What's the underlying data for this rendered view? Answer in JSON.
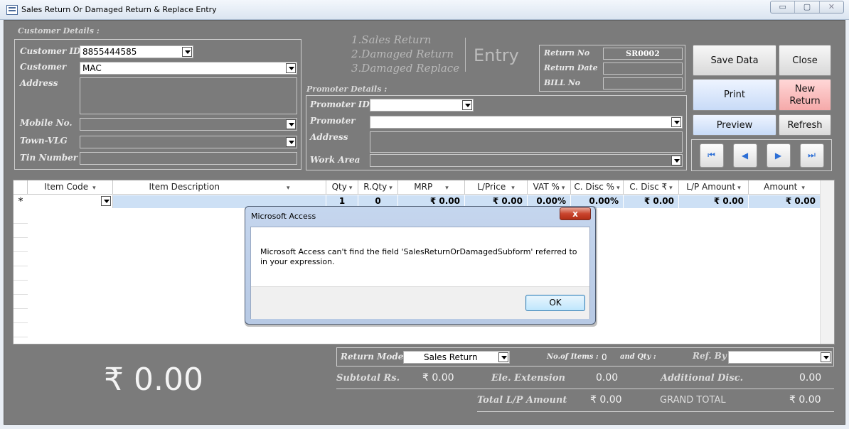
{
  "window": {
    "title": "Sales Return Or Damaged Return & Replace Entry",
    "minimize": "▭",
    "maximize": "▢",
    "close": "✕"
  },
  "customer": {
    "section_label": "Customer Details :",
    "id_label": "Customer ID",
    "id_value": "8855444585",
    "name_label": "Customer",
    "name_value": "MAC",
    "address_label": "Address",
    "mobile_label": "Mobile No.",
    "town_label": "Town-VLG",
    "tin_label": "Tin Number"
  },
  "entry_types": {
    "line1": "1.Sales Return",
    "line2": "2.Damaged Return",
    "line3": "3.Damaged Replace",
    "entry": "Entry"
  },
  "return_info": {
    "no_label": "Return No",
    "no_value": "SR0002",
    "date_label": "Return Date",
    "bill_label": "BILL No"
  },
  "promoter": {
    "section_label": "Promoter Details :",
    "id_label": "Promoter ID",
    "name_label": "Promoter",
    "address_label": "Address",
    "area_label": "Work Area"
  },
  "buttons": {
    "save": "Save Data",
    "close": "Close",
    "print": "Print",
    "new_return": "New Return",
    "preview": "Preview",
    "refresh": "Refresh"
  },
  "nav": {
    "first": "⏮",
    "prev": "◀",
    "next": "▶",
    "last": "⏭"
  },
  "grid": {
    "headers": [
      "Item Code",
      "Item Description",
      "Qty",
      "R.Qty",
      "MRP",
      "L/Price",
      "VAT %",
      "C. Disc %",
      "C. Disc ₹",
      "L/P Amount",
      "Amount"
    ],
    "new_row_marker": "*",
    "row": {
      "qty": "1",
      "rqty": "0",
      "mrp": "₹ 0.00",
      "lprice": "₹ 0.00",
      "vat": "0.00%",
      "cdisc_pct": "0.00%",
      "cdisc_amt": "₹ 0.00",
      "lp_amount": "₹ 0.00",
      "amount": "₹ 0.00"
    }
  },
  "dialog": {
    "title": "Microsoft Access",
    "close": "x",
    "message": "Microsoft Access can't find the field 'SalesReturnOrDamagedSubform' referred to in your expression.",
    "ok": "OK"
  },
  "footer": {
    "big_total": "₹ 0.00",
    "return_mode_label": "Return Mode",
    "return_mode_value": "Sales Return",
    "items_label": "No.of Items :",
    "items_value": "0",
    "qty_label": "and Qty :",
    "ref_label": "Ref. By",
    "subtotal_label": "Subtotal Rs.",
    "subtotal_value": "₹ 0.00",
    "ext_label": "Ele. Extension",
    "ext_value": "0.00",
    "addl_label": "Additional Disc.",
    "addl_value": "0.00",
    "lp_total_label": "Total L/P Amount",
    "lp_total_value": "₹ 0.00",
    "grand_label": "GRAND TOTAL",
    "grand_value": "₹ 0.00"
  }
}
